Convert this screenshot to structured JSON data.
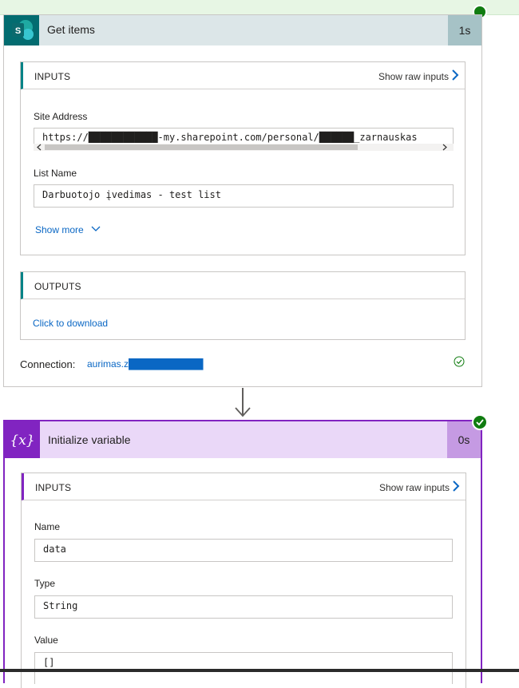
{
  "action1": {
    "title": "Get items",
    "duration": "1s",
    "inputs": {
      "section_title": "INPUTS",
      "show_raw": "Show raw inputs",
      "site_address_label": "Site Address",
      "site_address_value": "https://████████████-my.sharepoint.com/personal/██████_zarnauskas",
      "list_name_label": "List Name",
      "list_name_value": "Darbuotojo įvedimas - test list",
      "show_more": "Show more"
    },
    "outputs": {
      "section_title": "OUTPUTS",
      "download_link": "Click to download"
    },
    "connection_label": "Connection:",
    "connection_value": "aurimas.z███████████"
  },
  "action2": {
    "title": "Initialize variable",
    "duration": "0s",
    "inputs": {
      "section_title": "INPUTS",
      "show_raw": "Show raw inputs",
      "name_label": "Name",
      "name_value": "data",
      "type_label": "Type",
      "type_value": "String",
      "value_label": "Value",
      "value_value": "[]"
    }
  },
  "colors": {
    "sharepoint_teal": "#036c70",
    "variable_purple": "#8124c1",
    "link_blue": "#0a67c4",
    "success_green": "#107c10"
  },
  "icons": [
    "sharepoint-icon",
    "variable-icon",
    "chevron-right-icon",
    "chevron-down-icon",
    "success-check-icon",
    "down-arrow-icon"
  ]
}
